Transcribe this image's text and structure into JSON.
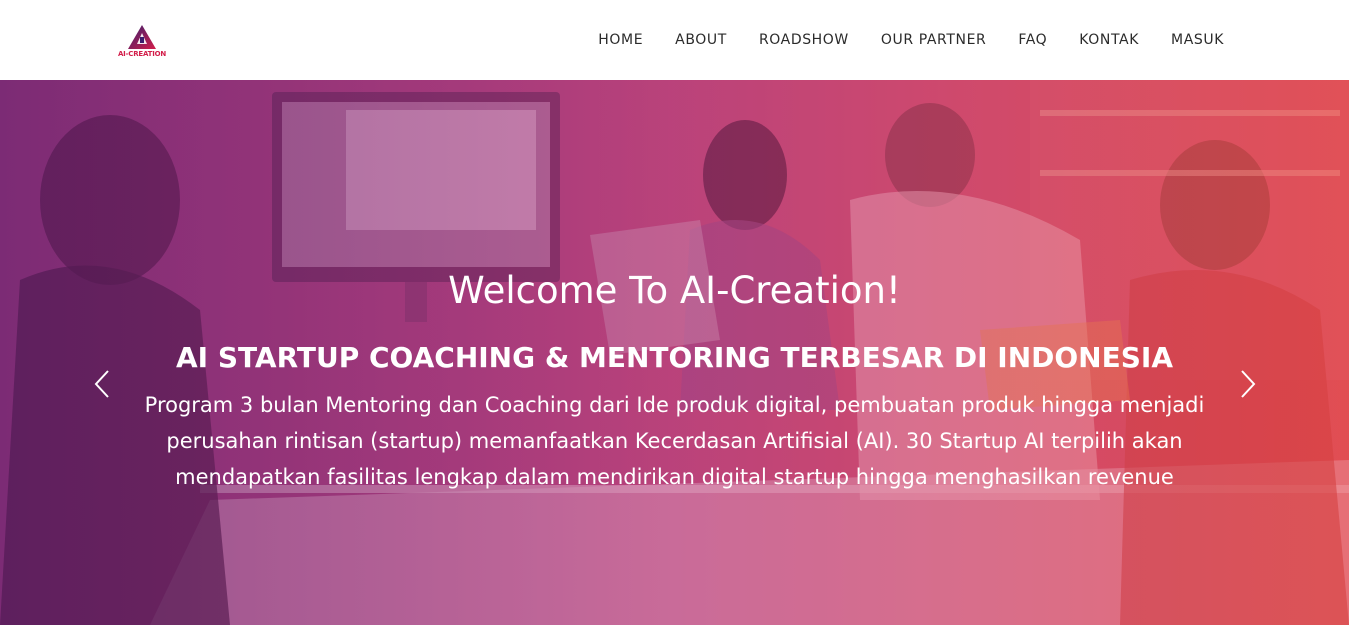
{
  "header": {
    "logo_text": "AI-CREATION",
    "nav": [
      "HOME",
      "ABOUT",
      "ROADSHOW",
      "OUR PARTNER",
      "FAQ",
      "KONTAK",
      "MASUK"
    ]
  },
  "hero": {
    "welcome": "Welcome To AI-Creation!",
    "headline": "AI STARTUP COACHING & MENTORING TERBESAR DI INDONESIA",
    "description": "Program 3 bulan Mentoring dan Coaching dari Ide produk digital, pembuatan produk hingga menjadi perusahan rintisan (startup) memanfaatkan Kecerdasan Artifisial (AI). 30 Startup AI terpilih akan mendapatkan fasilitas lengkap dalam mendirikan digital startup hingga menghasilkan revenue",
    "prev_icon": "chevron-left-icon",
    "next_icon": "chevron-right-icon"
  },
  "colors": {
    "brand": "#d31e4a",
    "logo_dark": "#3a1f6e",
    "overlay_left": "#7a2a78",
    "overlay_right": "#ec5b4b",
    "nav_text": "#2b2b2b"
  }
}
